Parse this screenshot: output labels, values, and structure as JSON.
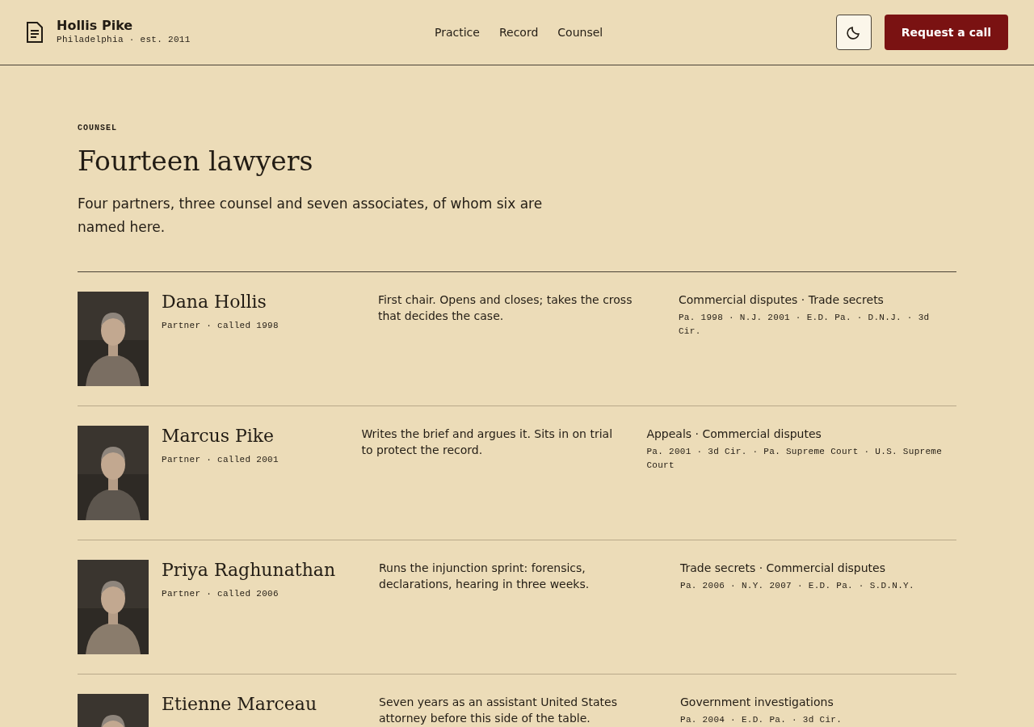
{
  "brand": {
    "name": "Hollis Pike",
    "tagline": "Philadelphia · est. 2011"
  },
  "nav": [
    {
      "label": "Practice"
    },
    {
      "label": "Record"
    },
    {
      "label": "Counsel"
    }
  ],
  "cta": "Request a call",
  "section": {
    "eyebrow": "COUNSEL",
    "title": "Fourteen lawyers",
    "lead": "Four partners, three counsel and seven associates, of whom six are named here."
  },
  "lawyers": [
    {
      "name": "Dana Hollis",
      "role": "Partner · called 1998",
      "bio": "First chair. Opens and closes; takes the cross that decides the case.",
      "practice": "Commercial disputes · Trade secrets",
      "admissions": "Pa. 1998 · N.J. 2001 · E.D. Pa. · D.N.J. · 3d Cir."
    },
    {
      "name": "Marcus Pike",
      "role": "Partner · called 2001",
      "bio": "Writes the brief and argues it. Sits in on trial to protect the record.",
      "practice": "Appeals · Commercial disputes",
      "admissions": "Pa. 2001 · 3d Cir. · Pa. Supreme Court · U.S. Supreme Court"
    },
    {
      "name": "Priya Raghunathan",
      "role": "Partner · called 2006",
      "bio": "Runs the injunction sprint: forensics, declarations, hearing in three weeks.",
      "practice": "Trade secrets · Commercial disputes",
      "admissions": "Pa. 2006 · N.Y. 2007 · E.D. Pa. · S.D.N.Y."
    },
    {
      "name": "Etienne Marceau",
      "bio": "Seven years as an assistant United States attorney before this side of the table.",
      "practice": "Government investigations",
      "admissions": "Pa. 2004 · E.D. Pa. · 3d Cir."
    }
  ]
}
